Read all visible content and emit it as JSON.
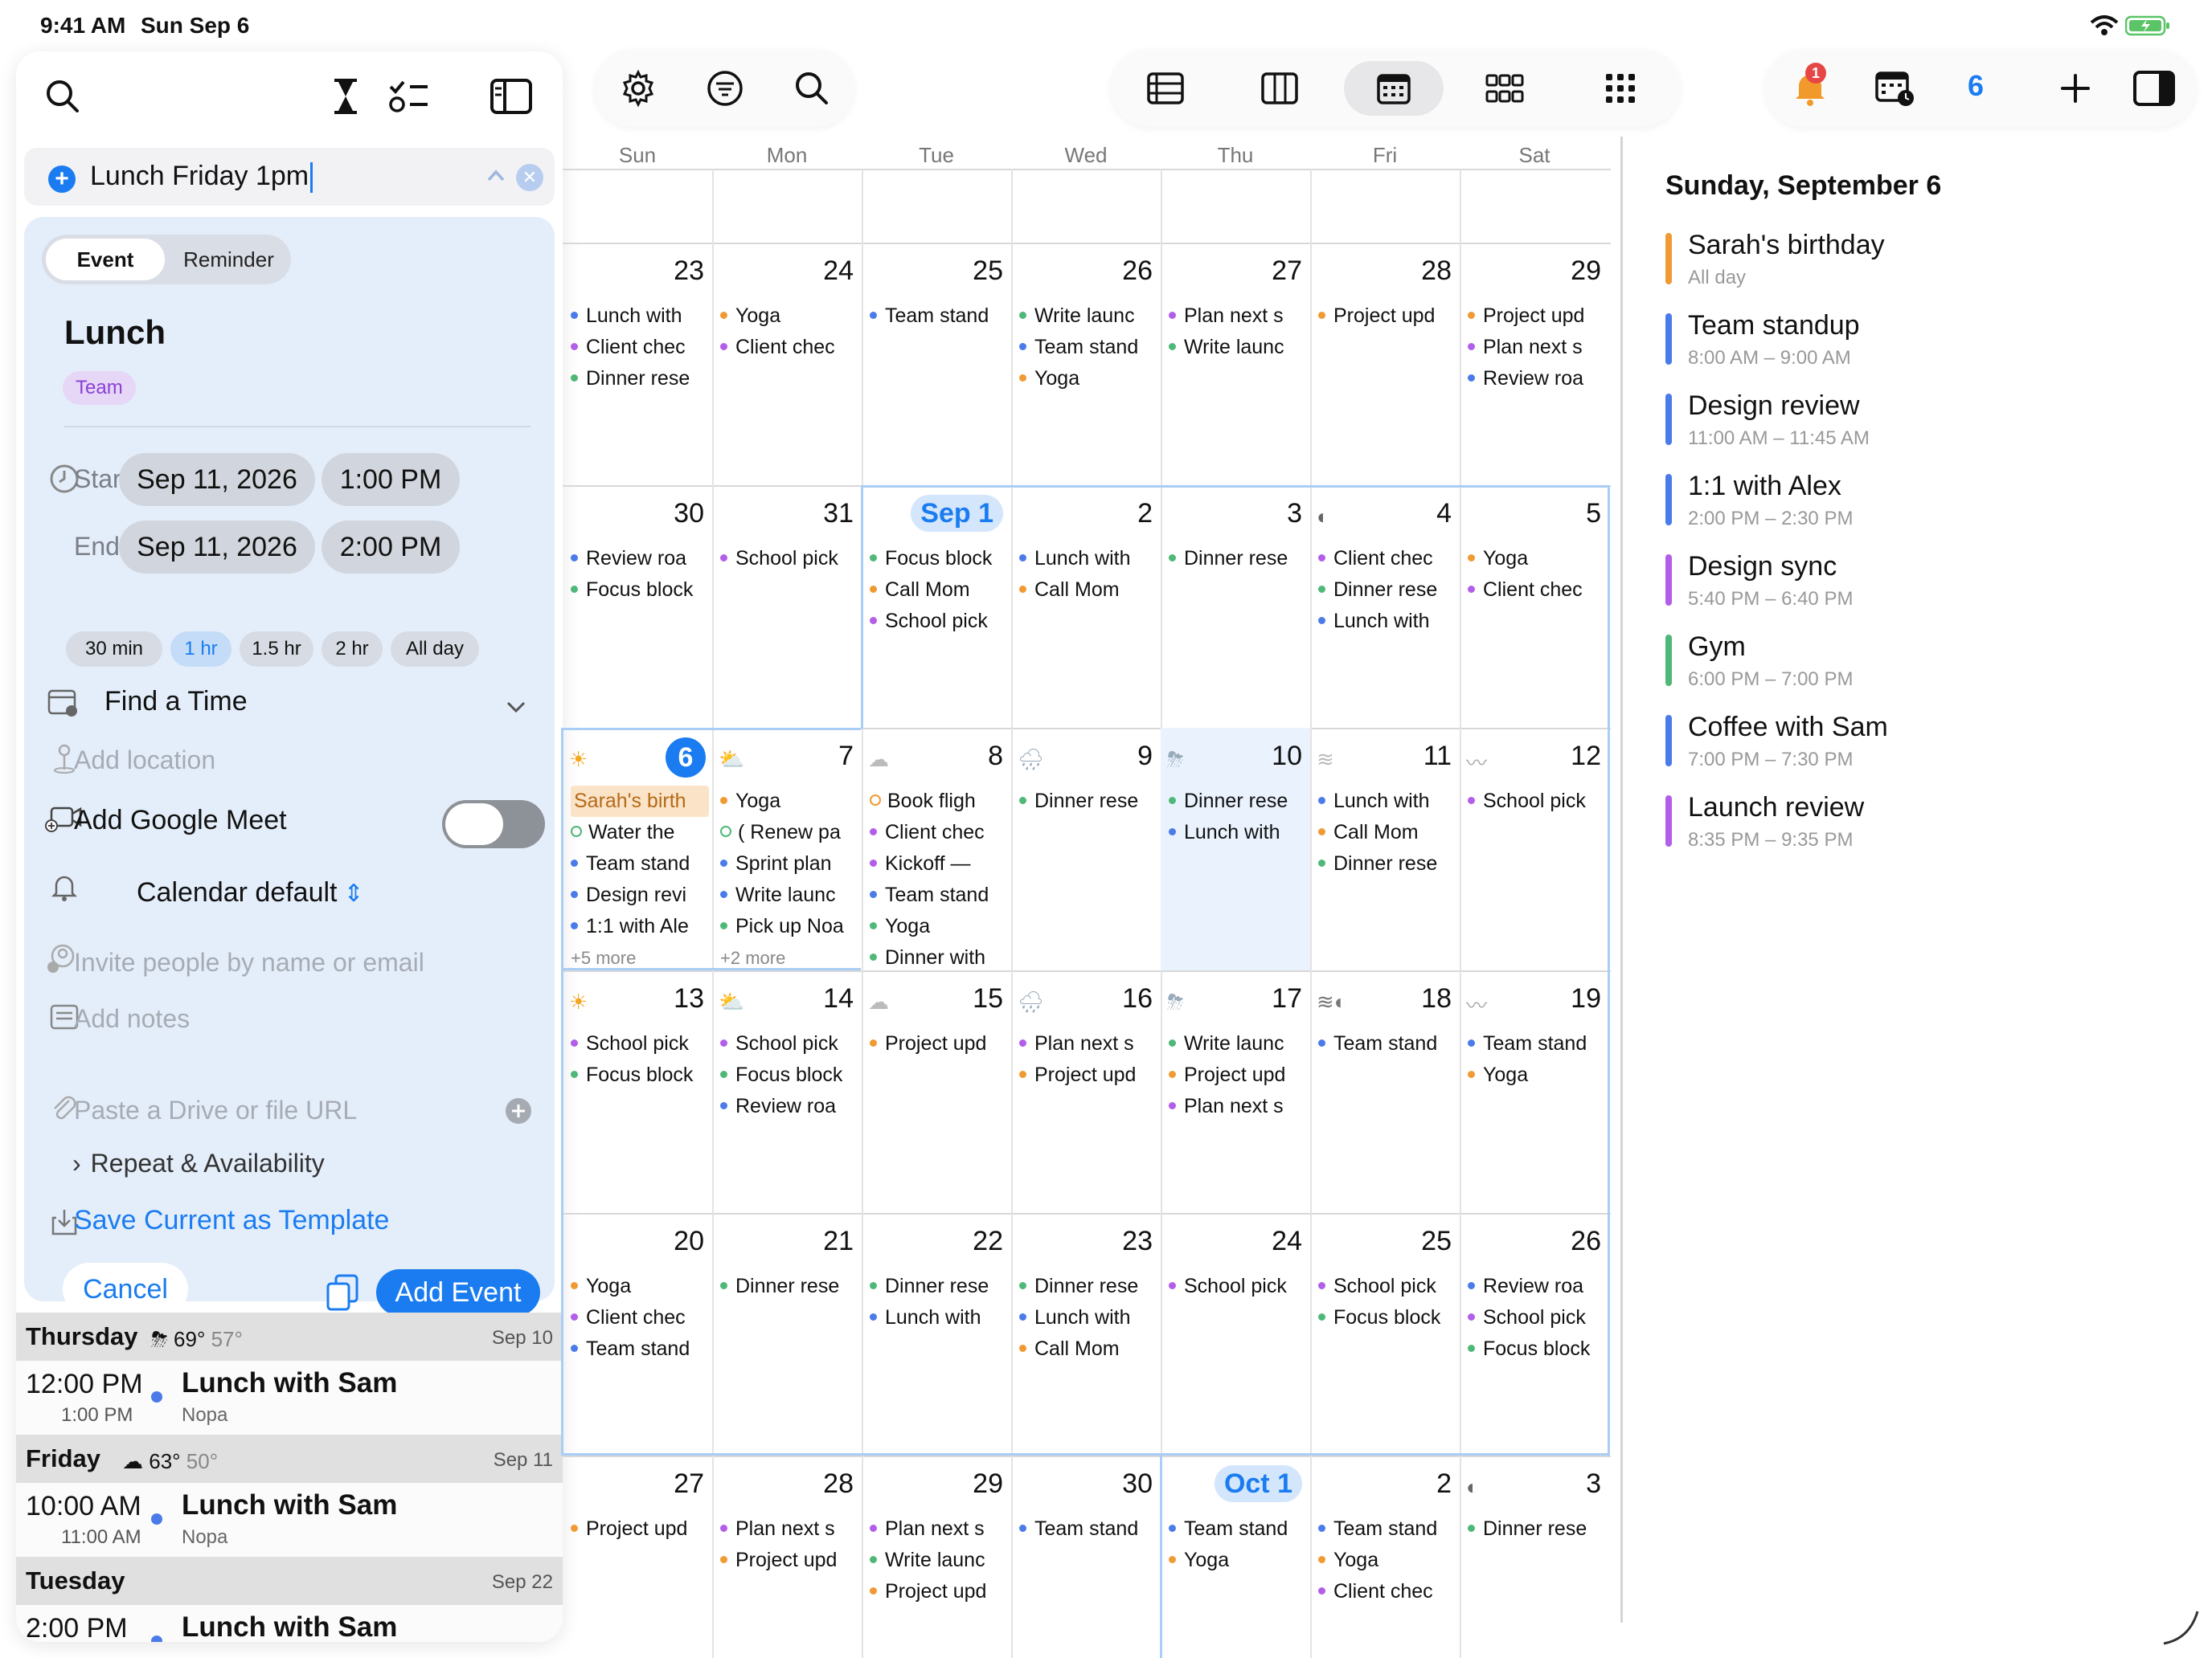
{
  "status": {
    "time": "9:41 AM",
    "date": "Sun Sep 6"
  },
  "quick_add": {
    "query": "Lunch Friday 1pm"
  },
  "form": {
    "seg_event": "Event",
    "seg_reminder": "Reminder",
    "title": "Lunch",
    "calendar_chip": "Team",
    "starts_label": "Starts",
    "ends_label": "Ends",
    "start_date": "Sep 11, 2026",
    "start_time": "1:00 PM",
    "end_date": "Sep 11, 2026",
    "end_time": "2:00 PM",
    "durations": [
      "30 min",
      "1 hr",
      "1.5 hr",
      "2 hr",
      "All day"
    ],
    "selected_duration": "1 hr",
    "find_time": "Find a Time",
    "location_placeholder": "Add location",
    "meet_label": "Add Google Meet",
    "alert": "Calendar default",
    "invite_placeholder": "Invite people by name or email",
    "notes_placeholder": "Add notes",
    "attach_placeholder": "Paste a Drive or file URL",
    "repeat": "Repeat & Availability",
    "save_template": "Save Current as Template",
    "cancel": "Cancel",
    "add_event": "Add Event"
  },
  "agenda": [
    {
      "day": "Thursday",
      "weather": "69°",
      "weather_low": "57°",
      "date": "Sep 10",
      "start": "12:00 PM",
      "end": "1:00 PM",
      "title": "Lunch with Sam",
      "location": "Nopa"
    },
    {
      "day": "Friday",
      "weather": "63°",
      "weather_low": "50°",
      "date": "Sep 11",
      "start": "10:00 AM",
      "end": "11:00 AM",
      "title": "Lunch with Sam",
      "location": "Nopa"
    },
    {
      "day": "Tuesday",
      "weather": "",
      "weather_low": "",
      "date": "Sep 22",
      "start": "2:00 PM",
      "end": "",
      "title": "Lunch with Sam",
      "location": ""
    }
  ],
  "toolbar": {
    "notifications_badge": "1",
    "today_count": "6"
  },
  "calendar": {
    "weekdays": [
      "Sun",
      "Mon",
      "Tue",
      "Wed",
      "Thu",
      "Fri",
      "Sat"
    ],
    "colors": {
      "blue": "#4a7be8",
      "green": "#4fb878",
      "purple": "#b35ee8",
      "orange": "#f09a34"
    },
    "weeks": [
      [
        {
          "n": "23",
          "ev": [
            [
              "blue",
              "Lunch with"
            ],
            [
              "purple",
              "Client chec"
            ],
            [
              "green",
              "Dinner rese"
            ]
          ]
        },
        {
          "n": "24",
          "ev": [
            [
              "orange",
              "Yoga"
            ],
            [
              "purple",
              "Client chec"
            ]
          ]
        },
        {
          "n": "25",
          "ev": [
            [
              "blue",
              "Team stand"
            ]
          ]
        },
        {
          "n": "26",
          "ev": [
            [
              "green",
              "Write launc"
            ],
            [
              "blue",
              "Team stand"
            ],
            [
              "orange",
              "Yoga"
            ]
          ]
        },
        {
          "n": "27",
          "ev": [
            [
              "purple",
              "Plan next s"
            ],
            [
              "green",
              "Write launc"
            ]
          ]
        },
        {
          "n": "28",
          "ev": [
            [
              "orange",
              "Project upd"
            ]
          ]
        },
        {
          "n": "29",
          "ev": [
            [
              "orange",
              "Project upd"
            ],
            [
              "purple",
              "Plan next s"
            ],
            [
              "blue",
              "Review roa"
            ]
          ]
        }
      ],
      [
        {
          "n": "30",
          "ev": [
            [
              "blue",
              "Review roa"
            ],
            [
              "green",
              "Focus block"
            ]
          ]
        },
        {
          "n": "31",
          "ev": [
            [
              "purple",
              "School pick"
            ]
          ]
        },
        {
          "n": "Sep 1",
          "pill": true,
          "ev": [
            [
              "green",
              "Focus block"
            ],
            [
              "orange",
              "Call Mom"
            ],
            [
              "purple",
              "School pick"
            ]
          ]
        },
        {
          "n": "2",
          "ev": [
            [
              "blue",
              "Lunch with"
            ],
            [
              "orange",
              "Call Mom"
            ]
          ]
        },
        {
          "n": "3",
          "ev": [
            [
              "green",
              "Dinner rese"
            ]
          ]
        },
        {
          "n": "4",
          "wx": "half-moon",
          "ev": [
            [
              "purple",
              "Client chec"
            ],
            [
              "green",
              "Dinner rese"
            ],
            [
              "blue",
              "Lunch with"
            ]
          ]
        },
        {
          "n": "5",
          "ev": [
            [
              "orange",
              "Yoga"
            ],
            [
              "purple",
              "Client chec"
            ]
          ]
        }
      ],
      [
        {
          "n": "6",
          "today": true,
          "wx": "sun",
          "allday": "Sarah's birth",
          "ev": [
            [
              "ring-green",
              "Water the"
            ],
            [
              "blue",
              "Team stand"
            ],
            [
              "blue",
              "Design revi"
            ],
            [
              "blue",
              "1:1 with Ale"
            ]
          ],
          "more": "+5 more"
        },
        {
          "n": "7",
          "wx": "sun-cloud",
          "ev": [
            [
              "orange",
              "Yoga"
            ],
            [
              "ring-green",
              "( Renew pa"
            ],
            [
              "blue",
              "Sprint plan"
            ],
            [
              "blue",
              "Write launc"
            ],
            [
              "green",
              "Pick up Noa"
            ]
          ],
          "more": "+2 more"
        },
        {
          "n": "8",
          "wx": "cloud",
          "ev": [
            [
              "ring-orange",
              "Book fligh"
            ],
            [
              "purple",
              "Client chec"
            ],
            [
              "purple",
              "Kickoff —"
            ],
            [
              "blue",
              "Team stand"
            ],
            [
              "green",
              "Yoga"
            ],
            [
              "green",
              "Dinner with"
            ]
          ]
        },
        {
          "n": "9",
          "wx": "rain",
          "ev": [
            [
              "green",
              "Dinner rese"
            ]
          ]
        },
        {
          "n": "10",
          "wx": "storm",
          "hl": true,
          "ev": [
            [
              "green",
              "Dinner rese"
            ],
            [
              "blue",
              "Lunch with"
            ]
          ]
        },
        {
          "n": "11",
          "wx": "fog",
          "ev": [
            [
              "blue",
              "Lunch with"
            ],
            [
              "orange",
              "Call Mom"
            ],
            [
              "green",
              "Dinner rese"
            ]
          ]
        },
        {
          "n": "12",
          "wx": "wind",
          "ev": [
            [
              "purple",
              "School pick"
            ]
          ]
        }
      ],
      [
        {
          "n": "13",
          "wx": "sun",
          "ev": [
            [
              "purple",
              "School pick"
            ],
            [
              "green",
              "Focus block"
            ]
          ]
        },
        {
          "n": "14",
          "wx": "sun-cloud",
          "ev": [
            [
              "purple",
              "School pick"
            ],
            [
              "green",
              "Focus block"
            ],
            [
              "blue",
              "Review roa"
            ]
          ]
        },
        {
          "n": "15",
          "wx": "cloud",
          "ev": [
            [
              "orange",
              "Project upd"
            ]
          ]
        },
        {
          "n": "16",
          "wx": "rain",
          "ev": [
            [
              "purple",
              "Plan next s"
            ],
            [
              "orange",
              "Project upd"
            ]
          ]
        },
        {
          "n": "17",
          "wx": "storm",
          "ev": [
            [
              "green",
              "Write launc"
            ],
            [
              "orange",
              "Project upd"
            ],
            [
              "purple",
              "Plan next s"
            ]
          ]
        },
        {
          "n": "18",
          "wx": "fog-half",
          "ev": [
            [
              "blue",
              "Team stand"
            ]
          ]
        },
        {
          "n": "19",
          "wx": "wind",
          "ev": [
            [
              "blue",
              "Team stand"
            ],
            [
              "orange",
              "Yoga"
            ]
          ]
        }
      ],
      [
        {
          "n": "20",
          "ev": [
            [
              "orange",
              "Yoga"
            ],
            [
              "purple",
              "Client chec"
            ],
            [
              "blue",
              "Team stand"
            ]
          ]
        },
        {
          "n": "21",
          "ev": [
            [
              "green",
              "Dinner rese"
            ]
          ]
        },
        {
          "n": "22",
          "ev": [
            [
              "green",
              "Dinner rese"
            ],
            [
              "blue",
              "Lunch with"
            ]
          ]
        },
        {
          "n": "23",
          "ev": [
            [
              "green",
              "Dinner rese"
            ],
            [
              "blue",
              "Lunch with"
            ],
            [
              "orange",
              "Call Mom"
            ]
          ]
        },
        {
          "n": "24",
          "ev": [
            [
              "purple",
              "School pick"
            ]
          ]
        },
        {
          "n": "25",
          "ev": [
            [
              "purple",
              "School pick"
            ],
            [
              "green",
              "Focus block"
            ]
          ]
        },
        {
          "n": "26",
          "ev": [
            [
              "blue",
              "Review roa"
            ],
            [
              "purple",
              "School pick"
            ],
            [
              "green",
              "Focus block"
            ]
          ]
        }
      ],
      [
        {
          "n": "27",
          "ev": [
            [
              "orange",
              "Project upd"
            ]
          ]
        },
        {
          "n": "28",
          "ev": [
            [
              "purple",
              "Plan next s"
            ],
            [
              "orange",
              "Project upd"
            ]
          ]
        },
        {
          "n": "29",
          "ev": [
            [
              "purple",
              "Plan next s"
            ],
            [
              "green",
              "Write launc"
            ],
            [
              "orange",
              "Project upd"
            ]
          ]
        },
        {
          "n": "30",
          "ev": [
            [
              "blue",
              "Team stand"
            ]
          ]
        },
        {
          "n": "Oct 1",
          "pill": true,
          "ev": [
            [
              "blue",
              "Team stand"
            ],
            [
              "orange",
              "Yoga"
            ]
          ]
        },
        {
          "n": "2",
          "ev": [
            [
              "blue",
              "Team stand"
            ],
            [
              "orange",
              "Yoga"
            ],
            [
              "purple",
              "Client chec"
            ]
          ]
        },
        {
          "n": "3",
          "wx": "half-moon",
          "ev": [
            [
              "green",
              "Dinner rese"
            ]
          ]
        }
      ]
    ]
  },
  "day_panel": {
    "title": "Sunday, September 6",
    "items": [
      {
        "name": "Sarah's birthday",
        "time": "All day",
        "color": "#f09a34"
      },
      {
        "name": "Team standup",
        "time": "8:00 AM – 9:00 AM",
        "color": "#4a7be8"
      },
      {
        "name": "Design review",
        "time": "11:00 AM – 11:45 AM",
        "color": "#4a7be8"
      },
      {
        "name": "1:1 with Alex",
        "time": "2:00 PM – 2:30 PM",
        "color": "#4a7be8"
      },
      {
        "name": "Design sync",
        "time": "5:40 PM – 6:40 PM",
        "color": "#b35ee8"
      },
      {
        "name": "Gym",
        "time": "6:00 PM – 7:00 PM",
        "color": "#4fb878"
      },
      {
        "name": "Coffee with Sam",
        "time": "7:00 PM – 7:30 PM",
        "color": "#4a7be8"
      },
      {
        "name": "Launch review",
        "time": "8:35 PM – 9:35 PM",
        "color": "#b35ee8"
      }
    ]
  }
}
